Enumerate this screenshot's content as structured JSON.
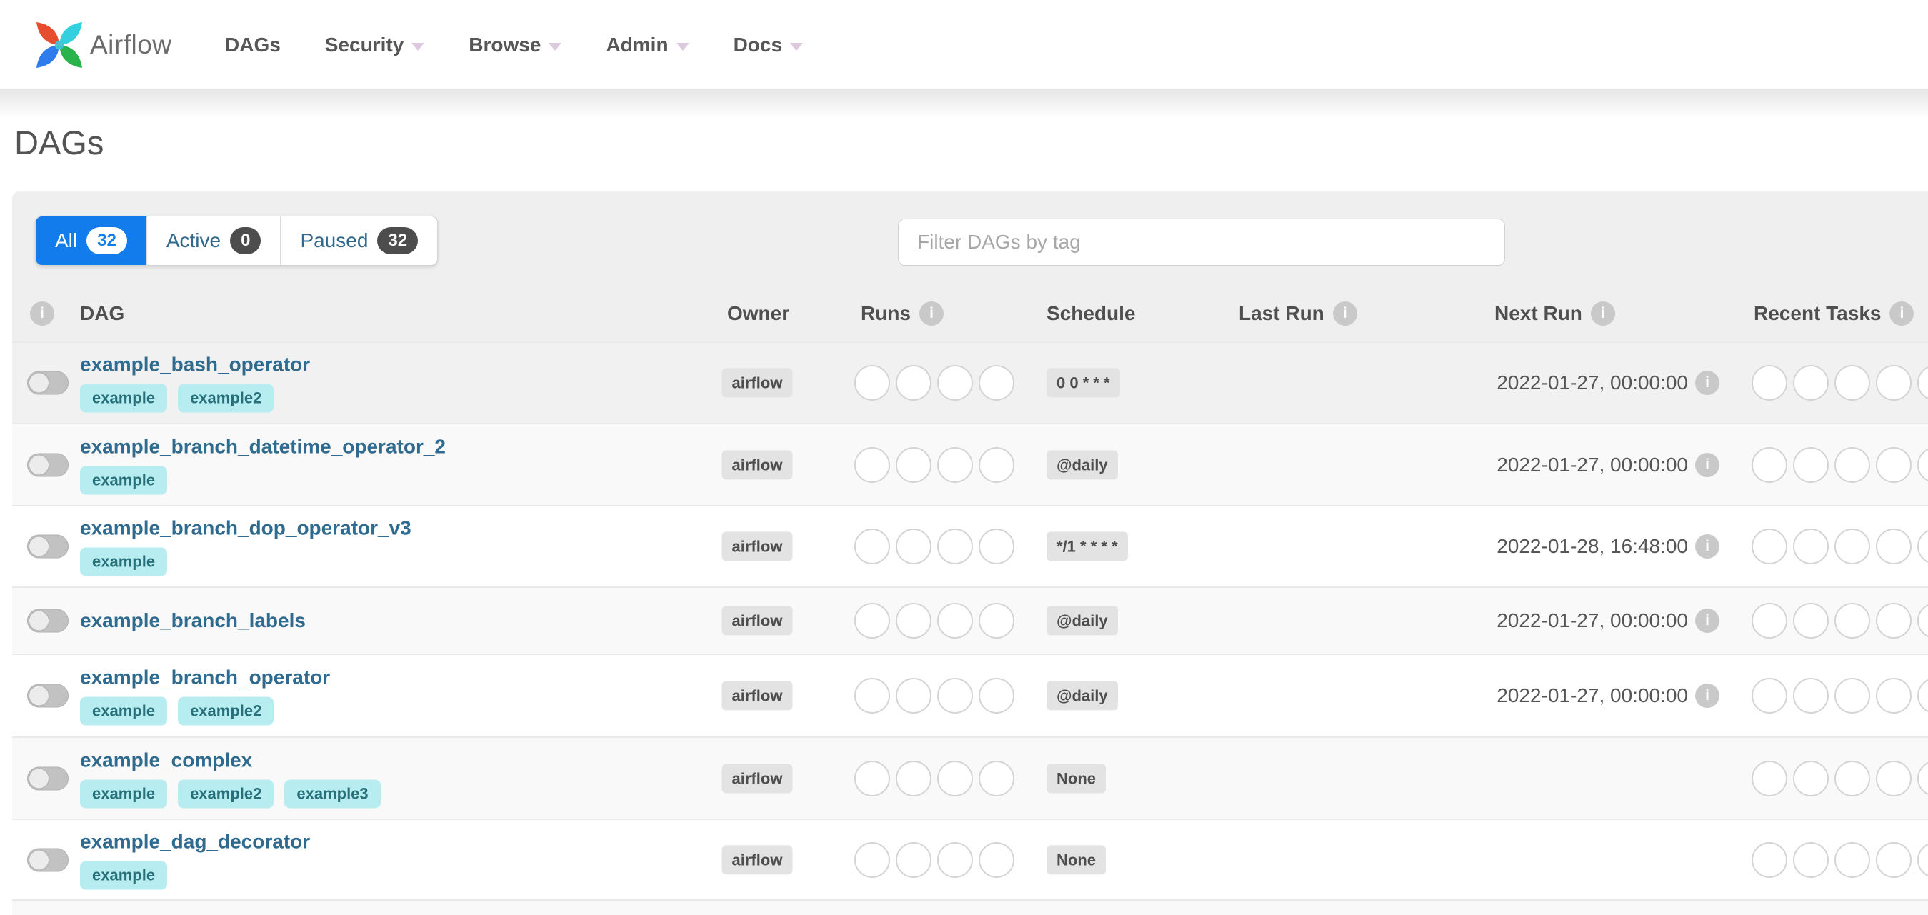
{
  "colors": {
    "accent_blue": "#127ced",
    "link_blue": "#2f6a8f",
    "tag_bg": "#b7edf0",
    "tag_text": "#27707a",
    "badge_bg": "#e3e3e3"
  },
  "navbar": {
    "brand": "Airflow",
    "items": [
      {
        "label": "DAGs",
        "dropdown": false
      },
      {
        "label": "Security",
        "dropdown": true
      },
      {
        "label": "Browse",
        "dropdown": true
      },
      {
        "label": "Admin",
        "dropdown": true
      },
      {
        "label": "Docs",
        "dropdown": true
      }
    ]
  },
  "page_title": "DAGs",
  "tabs": [
    {
      "label": "All",
      "count": "32",
      "active": true
    },
    {
      "label": "Active",
      "count": "0",
      "active": false
    },
    {
      "label": "Paused",
      "count": "32",
      "active": false
    }
  ],
  "search": {
    "placeholder": "Filter DAGs by tag"
  },
  "table": {
    "headers": {
      "dag": "DAG",
      "owner": "Owner",
      "runs": "Runs",
      "schedule": "Schedule",
      "last_run": "Last Run",
      "next_run": "Next Run",
      "recent_tasks": "Recent Tasks"
    },
    "runs_slots": 4,
    "recent_slots": 5,
    "rows": [
      {
        "name": "example_bash_operator",
        "tags": [
          "example",
          "example2"
        ],
        "owner": "airflow",
        "schedule": "0 0 * * *",
        "last_run": "",
        "next_run": "2022-01-27, 00:00:00"
      },
      {
        "name": "example_branch_datetime_operator_2",
        "tags": [
          "example"
        ],
        "owner": "airflow",
        "schedule": "@daily",
        "last_run": "",
        "next_run": "2022-01-27, 00:00:00"
      },
      {
        "name": "example_branch_dop_operator_v3",
        "tags": [
          "example"
        ],
        "owner": "airflow",
        "schedule": "*/1 * * * *",
        "last_run": "",
        "next_run": "2022-01-28, 16:48:00"
      },
      {
        "name": "example_branch_labels",
        "tags": [],
        "owner": "airflow",
        "schedule": "@daily",
        "last_run": "",
        "next_run": "2022-01-27, 00:00:00"
      },
      {
        "name": "example_branch_operator",
        "tags": [
          "example",
          "example2"
        ],
        "owner": "airflow",
        "schedule": "@daily",
        "last_run": "",
        "next_run": "2022-01-27, 00:00:00"
      },
      {
        "name": "example_complex",
        "tags": [
          "example",
          "example2",
          "example3"
        ],
        "owner": "airflow",
        "schedule": "None",
        "last_run": "",
        "next_run": ""
      },
      {
        "name": "example_dag_decorator",
        "tags": [
          "example"
        ],
        "owner": "airflow",
        "schedule": "None",
        "last_run": "",
        "next_run": ""
      }
    ]
  }
}
